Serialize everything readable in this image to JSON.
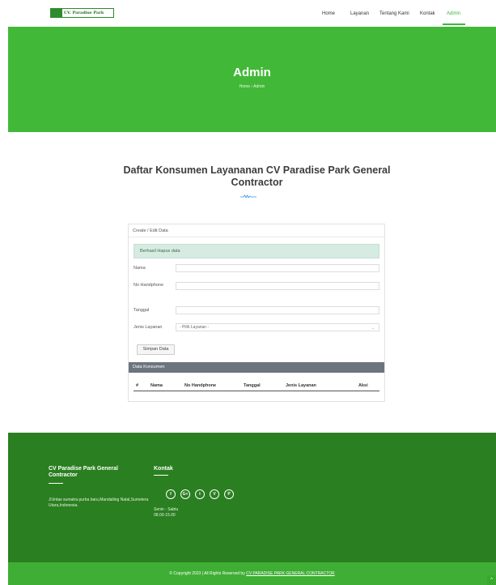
{
  "header": {
    "logo_text": "CV. Paradise Park",
    "nav": [
      {
        "label": "Home",
        "active": false
      },
      {
        "label": "Layanan",
        "active": false
      },
      {
        "label": "Tentang Kami",
        "active": false
      },
      {
        "label": "Kontak",
        "active": false
      },
      {
        "label": "Admin",
        "active": true
      }
    ]
  },
  "hero": {
    "title": "Admin",
    "breadcrumb": "Home  ›  Admin"
  },
  "section": {
    "title": "Daftar Konsumen Layananan CV Paradise Park General Contractor"
  },
  "form": {
    "card_title": "Create / Edit Data",
    "alert": "Berhasil Hapus data",
    "fields": {
      "nama": {
        "label": "Nama",
        "value": ""
      },
      "hp": {
        "label": "No Handphone",
        "value": ""
      },
      "tanggal": {
        "label": "Tanggal",
        "value": ""
      },
      "layanan": {
        "label": "Jenis Layanan",
        "value": "- Pilih Layanan -"
      }
    },
    "submit_label": "Simpan Data"
  },
  "table": {
    "title": "Data Konsumen",
    "columns": [
      "#",
      "Nama",
      "No Handphone",
      "Tanggal",
      "Jenis Layanan",
      "Aksi"
    ],
    "rows": []
  },
  "footer": {
    "company_title": "CV Paradise Park General Contractor",
    "address": "Jl.lintas sumatra purba baru,Mandailing Natal,Sumetera Utara,Indonesia.",
    "contact_title": "Kontak",
    "social_icons": [
      "facebook-icon",
      "google-plus-icon",
      "twitter-icon",
      "vine-icon",
      "pinterest-icon"
    ],
    "social_glyphs": [
      "f",
      "G+",
      "t",
      "V",
      "P"
    ],
    "hours_days": "Senin - Sabtu",
    "hours_time": "08.00-15.00",
    "copyright_prefix": "© Copyright 2023 | All Rights Reserved by",
    "copyright_link": "CV PARADISE PARK GENERAL CONTRACTOR"
  },
  "colors": {
    "brand_green": "#42b838",
    "footer_green": "#2a7f20",
    "table_header": "#6c757d",
    "alert_bg": "#d6ebe1"
  }
}
